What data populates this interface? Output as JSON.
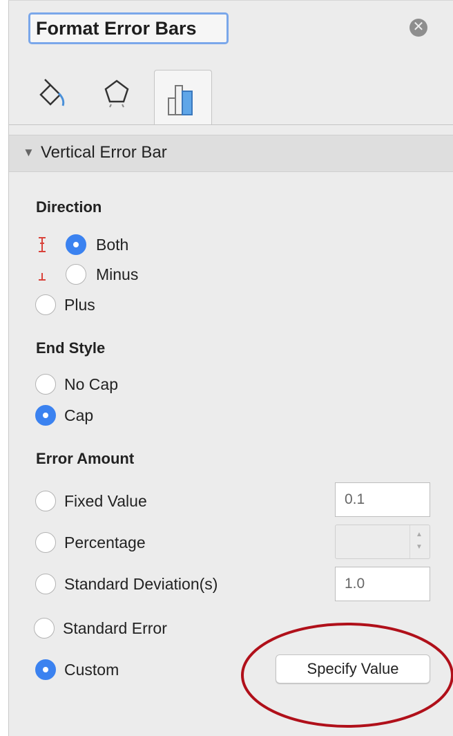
{
  "panel": {
    "title": "Format Error Bars",
    "tabs": [
      {
        "name": "fill-line",
        "icon": "paint-bucket-icon"
      },
      {
        "name": "effects",
        "icon": "pentagon-icon"
      },
      {
        "name": "error-bar-options",
        "icon": "bar-chart-icon",
        "selected": true
      }
    ]
  },
  "section": {
    "title": "Vertical Error Bar",
    "expanded": true
  },
  "direction": {
    "heading": "Direction",
    "options": [
      {
        "label": "Both",
        "selected": true,
        "icon": "both-direction-icon"
      },
      {
        "label": "Minus",
        "selected": false,
        "icon": "minus-direction-icon"
      },
      {
        "label": "Plus",
        "selected": false
      }
    ]
  },
  "end_style": {
    "heading": "End Style",
    "options": [
      {
        "label": "No Cap",
        "selected": false
      },
      {
        "label": "Cap",
        "selected": true
      }
    ]
  },
  "error_amount": {
    "heading": "Error Amount",
    "fixed_value": {
      "label": "Fixed Value",
      "value": "0.1",
      "selected": false
    },
    "percentage": {
      "label": "Percentage",
      "value": "",
      "selected": false
    },
    "standard_deviation": {
      "label": "Standard Deviation(s)",
      "value": "1.0",
      "selected": false
    },
    "standard_error": {
      "label": "Standard Error",
      "selected": false
    },
    "custom": {
      "label": "Custom",
      "selected": true,
      "button_label": "Specify Value"
    }
  },
  "colors": {
    "accent": "#3b82f0",
    "title_focus_ring": "#7aa7ea",
    "direction_icon": "#d9423a",
    "annotation_ellipse": "#b0101a"
  }
}
